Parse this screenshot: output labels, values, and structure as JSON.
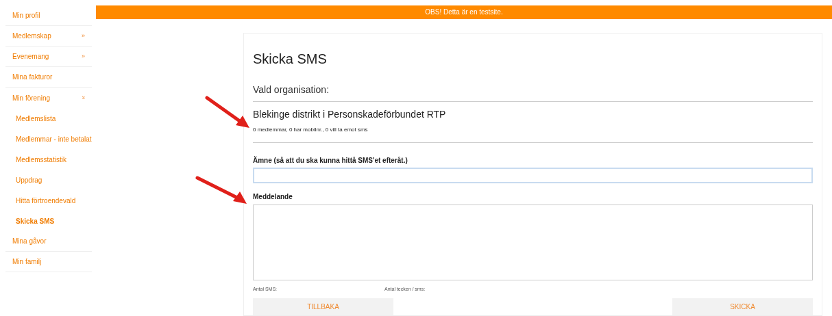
{
  "sidebar": {
    "items": [
      {
        "label": "Min profil",
        "expanded": false
      },
      {
        "label": "Medlemskap",
        "chevron": "»",
        "expanded": false
      },
      {
        "label": "Evenemang",
        "chevron": "»",
        "expanded": false
      },
      {
        "label": "Mina fakturor",
        "expanded": false
      },
      {
        "label": "Min förening",
        "chevron": "»",
        "expanded": true,
        "children": [
          {
            "label": "Medlemslista",
            "selected": false
          },
          {
            "label": "Medlemmar - inte betalat",
            "selected": false
          },
          {
            "label": "Medlemsstatistik",
            "selected": false
          },
          {
            "label": "Uppdrag",
            "selected": false
          },
          {
            "label": "Hitta förtroendevald",
            "selected": false
          },
          {
            "label": "Skicka SMS",
            "selected": true
          }
        ]
      },
      {
        "label": "Mina gåvor",
        "expanded": false
      },
      {
        "label": "Min familj",
        "expanded": false
      }
    ]
  },
  "banner": "OBS! Detta är en testsite.",
  "form": {
    "title": "Skicka SMS",
    "org_heading": "Vald organisation:",
    "org_name": "Blekinge distrikt i Personskadeförbundet RTP",
    "org_stats": "0 medlemmar, 0 har mobilnr., 0 vill ta emot sms",
    "subject_label": "Ämne (så att du ska kunna hittå SMS'et efteråt.)",
    "message_label": "Meddelande",
    "sms_count_label": "Antal SMS:",
    "chars_label": "Antal tecken / sms:",
    "back_button": "TILLBAKA",
    "send_button": "SKICKA"
  }
}
